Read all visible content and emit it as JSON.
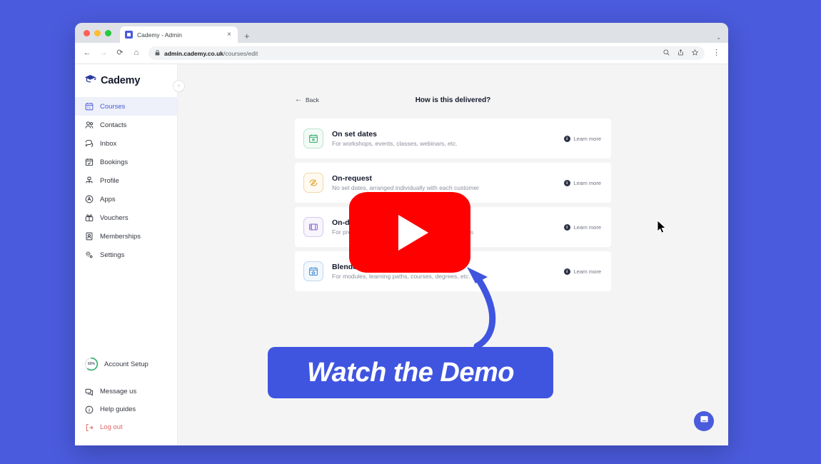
{
  "background_color": "#4a5bdd",
  "browser": {
    "tab": {
      "title": "Cademy - Admin",
      "close_label": "×",
      "new_tab_label": "+",
      "list_caret": "⌄"
    },
    "nav": {
      "back": "←",
      "forward": "→",
      "reload": "⟳",
      "home": "⌂"
    },
    "url": {
      "lock": "🔒",
      "domain": "admin.cademy.co.uk",
      "path": "/courses/edit"
    },
    "actions": {
      "zoom": "⊕",
      "share": "⤴",
      "bookmark": "☆",
      "menu": "⋮"
    }
  },
  "sidebar": {
    "brand": "Cademy",
    "collapse_label": "‹",
    "items": [
      {
        "label": "Courses",
        "icon": "calendar-icon",
        "active": true
      },
      {
        "label": "Contacts",
        "icon": "contacts-icon",
        "active": false
      },
      {
        "label": "Inbox",
        "icon": "inbox-icon",
        "active": false
      },
      {
        "label": "Bookings",
        "icon": "bookings-icon",
        "active": false
      },
      {
        "label": "Profile",
        "icon": "profile-icon",
        "active": false
      },
      {
        "label": "Apps",
        "icon": "apps-icon",
        "active": false
      },
      {
        "label": "Vouchers",
        "icon": "vouchers-icon",
        "active": false
      },
      {
        "label": "Memberships",
        "icon": "memberships-icon",
        "active": false
      },
      {
        "label": "Settings",
        "icon": "settings-icon",
        "active": false
      }
    ],
    "account_setup": {
      "label": "Account Setup",
      "percent": "60%",
      "progress": 60,
      "ring_color": "#3bb273"
    },
    "footer": [
      {
        "label": "Message us",
        "icon": "message-icon"
      },
      {
        "label": "Help guides",
        "icon": "info-circle-icon"
      },
      {
        "label": "Log out",
        "icon": "logout-icon"
      }
    ],
    "active_color": "#4a5bdd",
    "logout_color": "#e06464"
  },
  "main": {
    "back_label": "Back",
    "title": "How is this delivered?",
    "learn_more_label": "Learn more",
    "options": [
      {
        "title": "On set dates",
        "description": "For workshops, events, classes, webinars, etc.",
        "icon": "calendar-dot-icon",
        "color": "#3bb273"
      },
      {
        "title": "On-request",
        "description": "No set dates, arranged individually with each customer",
        "icon": "request-refresh-icon",
        "color": "#e0a93b"
      },
      {
        "title": "On-demand",
        "description": "For pre-recorded, self-paced e-learning programmes",
        "icon": "film-strip-icon",
        "color": "#8b6fd4"
      },
      {
        "title": "Blended",
        "description": "For modules, learning paths, courses, degrees, etc.",
        "icon": "calendar-star-icon",
        "color": "#4a8fd4"
      }
    ]
  },
  "overlay": {
    "play_button_label": "play-button",
    "play_button_color": "#ff0000",
    "banner_text": "Watch the Demo",
    "banner_color": "#3f55e0",
    "arrow_color": "#3f55e0"
  },
  "intercom": {
    "label": "chat-launcher"
  }
}
